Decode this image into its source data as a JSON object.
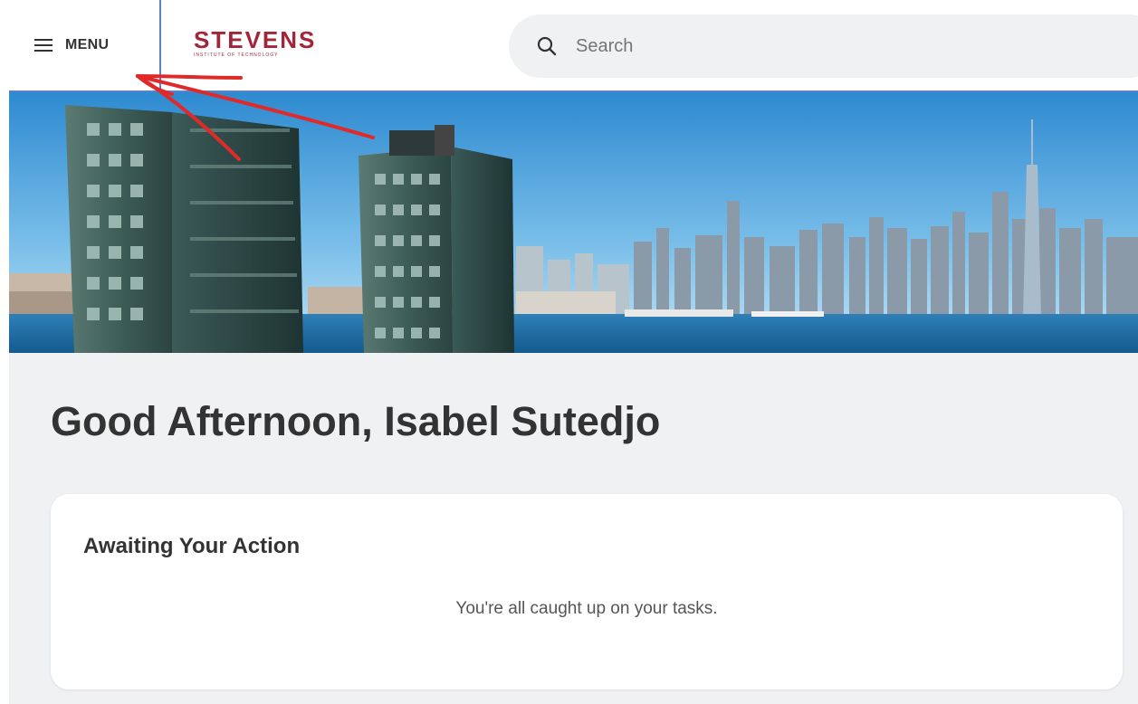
{
  "header": {
    "menu_label": "MENU",
    "logo_main": "STEVENS",
    "logo_sub": "INSTITUTE OF TECHNOLOGY",
    "search_placeholder": "Search"
  },
  "banner": {
    "description": "Hoboken waterfront and Manhattan skyline"
  },
  "greeting": "Good Afternoon, Isabel Sutedjo",
  "awaiting": {
    "title": "Awaiting Your Action",
    "empty_message": "You're all caught up on your tasks."
  },
  "colors": {
    "brand": "#a32638",
    "background": "#f0f1f2",
    "header_border": "#5a82c8",
    "annotation": "#e02a2a"
  },
  "icons": [
    "hamburger-icon",
    "search-icon"
  ]
}
